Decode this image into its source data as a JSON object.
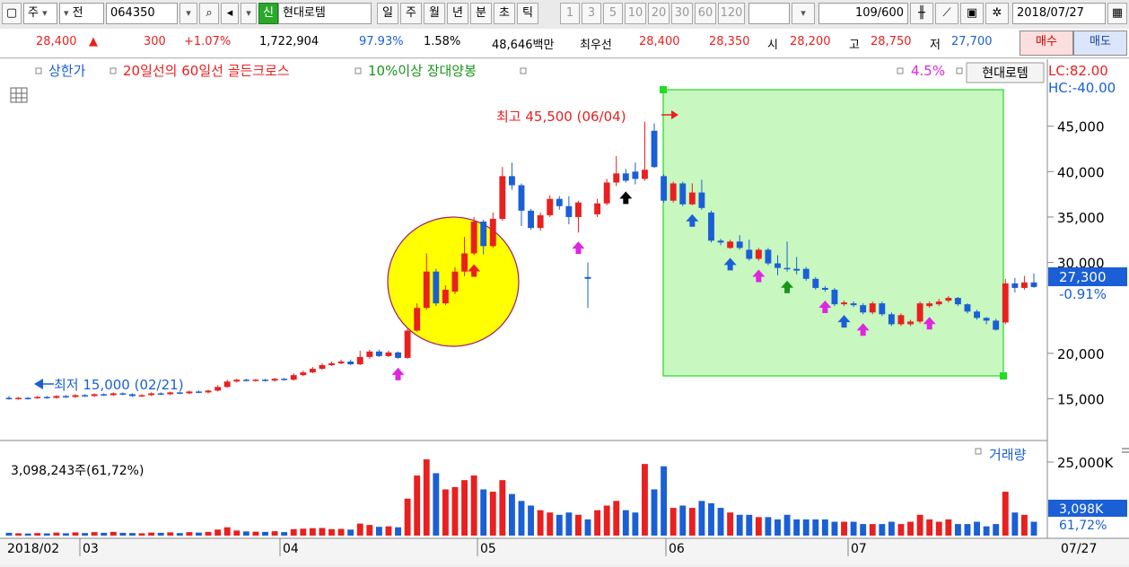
{
  "toolbar": {
    "period_type": "주",
    "scope": "전",
    "code": "064350",
    "badge": "신",
    "name": "현대로템",
    "tabs": [
      "일",
      "주",
      "월",
      "년",
      "분",
      "초",
      "틱"
    ],
    "active_tab": "일",
    "minutes": [
      "1",
      "3",
      "5",
      "10",
      "20",
      "30",
      "60",
      "120"
    ],
    "count": "109/600",
    "date": "2018/07/27"
  },
  "quote": {
    "price": "28,400",
    "direction": "▲",
    "change": "300",
    "change_pct": "+1.07%",
    "volume": "1,722,904",
    "vol_ratio": "97.93%",
    "turnover": "1.58%",
    "amount": "48,646백만",
    "best_label": "최우선",
    "ask": "28,400",
    "bid": "28,350",
    "open_label": "시",
    "open": "28,200",
    "high_label": "고",
    "high": "28,750",
    "low_label": "저",
    "low": "27,700",
    "buy_label": "매수",
    "sell_label": "매도"
  },
  "colors": {
    "up": "#e8201f",
    "down": "#1a5fd6",
    "magenta": "#e025e0",
    "yellow": "#ffff00",
    "green_box": "#c8f7c0",
    "green_border": "#22dd22"
  },
  "chart_data": {
    "type": "candlestick",
    "legend_left": [
      {
        "label": "상한가",
        "color": "#1a5fd6"
      },
      {
        "label": "20일선의 60일선 골든크로스",
        "color": "#e8201f"
      },
      {
        "label": "10%이상 장대양봉",
        "color": "#18941a"
      }
    ],
    "legend_right": {
      "label": "4.5%",
      "color": "#e025e0",
      "button": "현대로템"
    },
    "lc": "LC:82.00",
    "hc": "HC:-40.00",
    "y_ticks": [
      "45,000",
      "40,000",
      "35,000",
      "30,000",
      "20,000",
      "15,000"
    ],
    "y_tick_values": [
      45000,
      40000,
      35000,
      30000,
      20000,
      15000
    ],
    "ylim": [
      11000,
      50000
    ],
    "high_label": "최고 45,500 (06/04)",
    "low_label": "최저 15,000 (02/21)",
    "current_price": "27,300",
    "current_pct": "-0.91%",
    "x_labels": [
      "2018/02",
      "03",
      "04",
      "05",
      "06",
      "07",
      "07/27"
    ],
    "candles": [
      {
        "o": 15100,
        "c": 15000,
        "h": 15300,
        "l": 14900,
        "v": 120
      },
      {
        "o": 15000,
        "c": 15100,
        "h": 15200,
        "l": 14900,
        "v": 100
      },
      {
        "o": 15100,
        "c": 15050,
        "h": 15200,
        "l": 14900,
        "v": 90
      },
      {
        "o": 15050,
        "c": 15200,
        "h": 15300,
        "l": 15000,
        "v": 110
      },
      {
        "o": 15200,
        "c": 15100,
        "h": 15300,
        "l": 15000,
        "v": 95
      },
      {
        "o": 15100,
        "c": 15300,
        "h": 15400,
        "l": 15000,
        "v": 130
      },
      {
        "o": 15300,
        "c": 15200,
        "h": 15400,
        "l": 15100,
        "v": 100
      },
      {
        "o": 15200,
        "c": 15400,
        "h": 15500,
        "l": 15100,
        "v": 140
      },
      {
        "o": 15400,
        "c": 15300,
        "h": 15500,
        "l": 15200,
        "v": 110
      },
      {
        "o": 15300,
        "c": 15500,
        "h": 15600,
        "l": 15200,
        "v": 150
      },
      {
        "o": 15500,
        "c": 15400,
        "h": 15600,
        "l": 15300,
        "v": 120
      },
      {
        "o": 15400,
        "c": 15600,
        "h": 15700,
        "l": 15300,
        "v": 160
      },
      {
        "o": 15600,
        "c": 15500,
        "h": 15700,
        "l": 15400,
        "v": 120
      },
      {
        "o": 15500,
        "c": 15300,
        "h": 15600,
        "l": 15200,
        "v": 110
      },
      {
        "o": 15300,
        "c": 15400,
        "h": 15500,
        "l": 15200,
        "v": 100
      },
      {
        "o": 15400,
        "c": 15600,
        "h": 15700,
        "l": 15300,
        "v": 130
      },
      {
        "o": 15600,
        "c": 15500,
        "h": 15700,
        "l": 15400,
        "v": 120
      },
      {
        "o": 15500,
        "c": 15700,
        "h": 15800,
        "l": 15400,
        "v": 140
      },
      {
        "o": 15700,
        "c": 15600,
        "h": 15800,
        "l": 15500,
        "v": 110
      },
      {
        "o": 15600,
        "c": 15800,
        "h": 15900,
        "l": 15500,
        "v": 150
      },
      {
        "o": 15800,
        "c": 15700,
        "h": 15900,
        "l": 15600,
        "v": 130
      },
      {
        "o": 15700,
        "c": 15900,
        "h": 16000,
        "l": 15600,
        "v": 160
      },
      {
        "o": 15900,
        "c": 16300,
        "h": 16500,
        "l": 15800,
        "v": 260
      },
      {
        "o": 16300,
        "c": 16900,
        "h": 17100,
        "l": 16200,
        "v": 360
      },
      {
        "o": 16900,
        "c": 17100,
        "h": 17200,
        "l": 16800,
        "v": 220
      },
      {
        "o": 17100,
        "c": 17000,
        "h": 17200,
        "l": 16900,
        "v": 180
      },
      {
        "o": 17000,
        "c": 17100,
        "h": 17200,
        "l": 16900,
        "v": 170
      },
      {
        "o": 17100,
        "c": 17000,
        "h": 17200,
        "l": 16900,
        "v": 160
      },
      {
        "o": 17000,
        "c": 17200,
        "h": 17300,
        "l": 16900,
        "v": 190
      },
      {
        "o": 17200,
        "c": 17100,
        "h": 17300,
        "l": 17000,
        "v": 150
      },
      {
        "o": 17100,
        "c": 17600,
        "h": 17800,
        "l": 17000,
        "v": 280
      },
      {
        "o": 17600,
        "c": 17900,
        "h": 18100,
        "l": 17500,
        "v": 300
      },
      {
        "o": 17900,
        "c": 18300,
        "h": 18500,
        "l": 17800,
        "v": 320
      },
      {
        "o": 18300,
        "c": 18700,
        "h": 18900,
        "l": 18200,
        "v": 330
      },
      {
        "o": 18700,
        "c": 18900,
        "h": 19100,
        "l": 18600,
        "v": 280
      },
      {
        "o": 18900,
        "c": 19100,
        "h": 19300,
        "l": 18800,
        "v": 290
      },
      {
        "o": 19100,
        "c": 18800,
        "h": 19300,
        "l": 18700,
        "v": 260
      },
      {
        "o": 18800,
        "c": 19600,
        "h": 20300,
        "l": 18700,
        "v": 520
      },
      {
        "o": 19600,
        "c": 20200,
        "h": 20400,
        "l": 19400,
        "v": 460
      },
      {
        "o": 20200,
        "c": 19700,
        "h": 20400,
        "l": 19600,
        "v": 380
      },
      {
        "o": 19700,
        "c": 20100,
        "h": 20300,
        "l": 19600,
        "v": 400
      },
      {
        "o": 20100,
        "c": 19500,
        "h": 20200,
        "l": 19400,
        "v": 360
      },
      {
        "o": 19500,
        "c": 22500,
        "h": 22800,
        "l": 19400,
        "v": 1600
      },
      {
        "o": 22500,
        "c": 25000,
        "h": 25500,
        "l": 22400,
        "v": 2600
      },
      {
        "o": 25000,
        "c": 29000,
        "h": 31000,
        "l": 24800,
        "v": 3300
      },
      {
        "o": 29000,
        "c": 25500,
        "h": 29300,
        "l": 25200,
        "v": 2700
      },
      {
        "o": 25500,
        "c": 27000,
        "h": 27500,
        "l": 25300,
        "v": 2000
      },
      {
        "o": 26800,
        "c": 29000,
        "h": 29500,
        "l": 26500,
        "v": 2100
      },
      {
        "o": 29000,
        "c": 31000,
        "h": 32800,
        "l": 28500,
        "v": 2400
      },
      {
        "o": 31000,
        "c": 34500,
        "h": 35000,
        "l": 30800,
        "v": 2600
      },
      {
        "o": 34500,
        "c": 31800,
        "h": 34700,
        "l": 30900,
        "v": 2000
      },
      {
        "o": 31800,
        "c": 34800,
        "h": 35500,
        "l": 31600,
        "v": 1900
      },
      {
        "o": 34800,
        "c": 39500,
        "h": 40500,
        "l": 34600,
        "v": 2400
      },
      {
        "o": 39500,
        "c": 38500,
        "h": 41000,
        "l": 38000,
        "v": 1800
      },
      {
        "o": 38500,
        "c": 35700,
        "h": 38700,
        "l": 34000,
        "v": 1500
      },
      {
        "o": 35700,
        "c": 33800,
        "h": 35900,
        "l": 33600,
        "v": 1300
      },
      {
        "o": 33800,
        "c": 35200,
        "h": 35500,
        "l": 33500,
        "v": 1100
      },
      {
        "o": 35200,
        "c": 37000,
        "h": 37400,
        "l": 35000,
        "v": 1000
      },
      {
        "o": 37000,
        "c": 36200,
        "h": 37300,
        "l": 35800,
        "v": 900
      },
      {
        "o": 36200,
        "c": 35000,
        "h": 37300,
        "l": 34200,
        "v": 1000
      },
      {
        "o": 35000,
        "c": 36600,
        "h": 36800,
        "l": 33300,
        "v": 900
      },
      {
        "o": 28400,
        "c": 28200,
        "h": 30000,
        "l": 25000,
        "v": 700
      },
      {
        "o": 35300,
        "c": 36500,
        "h": 37000,
        "l": 35000,
        "v": 1100
      },
      {
        "o": 36500,
        "c": 38800,
        "h": 39200,
        "l": 36300,
        "v": 1300
      },
      {
        "o": 38800,
        "c": 39800,
        "h": 41700,
        "l": 38400,
        "v": 1500
      },
      {
        "o": 39800,
        "c": 39000,
        "h": 40300,
        "l": 38800,
        "v": 1100
      },
      {
        "o": 40000,
        "c": 39200,
        "h": 41000,
        "l": 38600,
        "v": 1000
      },
      {
        "o": 39200,
        "c": 40200,
        "h": 45500,
        "l": 39000,
        "v": 3100
      },
      {
        "o": 44500,
        "c": 40500,
        "h": 45300,
        "l": 40400,
        "v": 2000
      },
      {
        "o": 39500,
        "c": 36800,
        "h": 39700,
        "l": 36600,
        "v": 3000
      },
      {
        "o": 36800,
        "c": 38700,
        "h": 38900,
        "l": 36600,
        "v": 1200
      },
      {
        "o": 38700,
        "c": 36400,
        "h": 38900,
        "l": 36200,
        "v": 1300
      },
      {
        "o": 36400,
        "c": 37700,
        "h": 38700,
        "l": 36300,
        "v": 1200
      },
      {
        "o": 37700,
        "c": 36000,
        "h": 39100,
        "l": 35800,
        "v": 1500
      },
      {
        "o": 35500,
        "c": 32400,
        "h": 35700,
        "l": 32200,
        "v": 1400
      },
      {
        "o": 32400,
        "c": 32200,
        "h": 32600,
        "l": 31900,
        "v": 1200
      },
      {
        "o": 31600,
        "c": 32300,
        "h": 32500,
        "l": 31500,
        "v": 1000
      },
      {
        "o": 32300,
        "c": 31600,
        "h": 33000,
        "l": 31400,
        "v": 900
      },
      {
        "o": 31400,
        "c": 30400,
        "h": 32500,
        "l": 30200,
        "v": 900
      },
      {
        "o": 30400,
        "c": 31400,
        "h": 31600,
        "l": 30200,
        "v": 800
      },
      {
        "o": 31400,
        "c": 29900,
        "h": 31600,
        "l": 29700,
        "v": 800
      },
      {
        "o": 29900,
        "c": 29400,
        "h": 30800,
        "l": 28600,
        "v": 700
      },
      {
        "o": 29400,
        "c": 29300,
        "h": 32300,
        "l": 29000,
        "v": 900
      },
      {
        "o": 29300,
        "c": 29100,
        "h": 30600,
        "l": 28700,
        "v": 700
      },
      {
        "o": 29300,
        "c": 28200,
        "h": 29500,
        "l": 28000,
        "v": 700
      },
      {
        "o": 28200,
        "c": 27200,
        "h": 28400,
        "l": 27000,
        "v": 700
      },
      {
        "o": 27200,
        "c": 27000,
        "h": 27400,
        "l": 26800,
        "v": 700
      },
      {
        "o": 27000,
        "c": 25400,
        "h": 27200,
        "l": 25200,
        "v": 600
      },
      {
        "o": 25400,
        "c": 25600,
        "h": 25800,
        "l": 25200,
        "v": 600
      },
      {
        "o": 25500,
        "c": 25300,
        "h": 25700,
        "l": 25100,
        "v": 600
      },
      {
        "o": 25300,
        "c": 24500,
        "h": 25500,
        "l": 24300,
        "v": 500
      },
      {
        "o": 24500,
        "c": 25500,
        "h": 25700,
        "l": 24300,
        "v": 500
      },
      {
        "o": 25500,
        "c": 24300,
        "h": 25700,
        "l": 24100,
        "v": 500
      },
      {
        "o": 24300,
        "c": 23200,
        "h": 24500,
        "l": 23000,
        "v": 600
      },
      {
        "o": 23200,
        "c": 24200,
        "h": 24400,
        "l": 23000,
        "v": 500
      },
      {
        "o": 23200,
        "c": 23500,
        "h": 23700,
        "l": 23000,
        "v": 600
      },
      {
        "o": 23500,
        "c": 25500,
        "h": 25700,
        "l": 23300,
        "v": 900
      },
      {
        "o": 25200,
        "c": 25500,
        "h": 25700,
        "l": 25000,
        "v": 700
      },
      {
        "o": 25400,
        "c": 25700,
        "h": 26000,
        "l": 25200,
        "v": 600
      },
      {
        "o": 25800,
        "c": 26100,
        "h": 26300,
        "l": 25600,
        "v": 700
      },
      {
        "o": 26100,
        "c": 25400,
        "h": 26200,
        "l": 25200,
        "v": 500
      },
      {
        "o": 25400,
        "c": 24600,
        "h": 25500,
        "l": 24400,
        "v": 500
      },
      {
        "o": 24600,
        "c": 23900,
        "h": 24800,
        "l": 23700,
        "v": 600
      },
      {
        "o": 23900,
        "c": 23600,
        "h": 24000,
        "l": 23200,
        "v": 400
      },
      {
        "o": 23600,
        "c": 22600,
        "h": 23800,
        "l": 22500,
        "v": 500
      },
      {
        "o": 23400,
        "c": 27700,
        "h": 28200,
        "l": 23200,
        "v": 1900
      },
      {
        "o": 27700,
        "c": 27200,
        "h": 28300,
        "l": 26700,
        "v": 1000
      },
      {
        "o": 27200,
        "c": 27800,
        "h": 28500,
        "l": 27000,
        "v": 900
      },
      {
        "o": 27800,
        "c": 27300,
        "h": 28800,
        "l": 27200,
        "v": 600
      }
    ],
    "markers": [
      {
        "i": 41,
        "kind": "up",
        "color": "#e025e0",
        "label_side": "below"
      },
      {
        "i": 49,
        "kind": "up",
        "color": "#e8201f"
      },
      {
        "i": 60,
        "kind": "up",
        "color": "#e025e0"
      },
      {
        "i": 65,
        "kind": "up",
        "color": "#000000"
      },
      {
        "i": 72,
        "kind": "up",
        "color": "#1a5fd6"
      },
      {
        "i": 76,
        "kind": "up",
        "color": "#1a5fd6"
      },
      {
        "i": 79,
        "kind": "up",
        "color": "#e025e0"
      },
      {
        "i": 82,
        "kind": "up",
        "color": "#18941a"
      },
      {
        "i": 86,
        "kind": "up",
        "color": "#e025e0"
      },
      {
        "i": 88,
        "kind": "up",
        "color": "#1a5fd6"
      },
      {
        "i": 90,
        "kind": "up",
        "color": "#e025e0"
      },
      {
        "i": 97,
        "kind": "up",
        "color": "#e025e0"
      },
      {
        "i": 113,
        "kind": "up",
        "color": "#e025e0"
      },
      {
        "i": 123,
        "kind": "up",
        "color": "#18941a"
      }
    ],
    "volume_title": "거래량",
    "volume_label": "3,098,243주(61,72%)",
    "volume_y_tick": "25,000K",
    "volume_current": "3,098K",
    "volume_current_pct": "61,72%"
  }
}
